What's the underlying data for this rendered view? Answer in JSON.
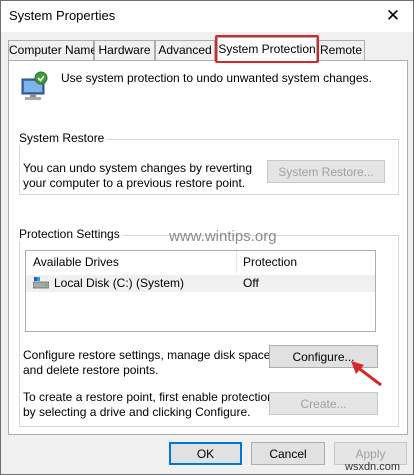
{
  "window": {
    "title": "System Properties",
    "close_glyph": "✕"
  },
  "tabs": [
    {
      "label": "Computer Name",
      "active": false
    },
    {
      "label": "Hardware",
      "active": false
    },
    {
      "label": "Advanced",
      "active": false
    },
    {
      "label": "System Protection",
      "active": true
    },
    {
      "label": "Remote",
      "active": false
    }
  ],
  "intro": {
    "icon": "system-protection-icon",
    "text": "Use system protection to undo unwanted system changes."
  },
  "system_restore": {
    "heading": "System Restore",
    "description_line1": "You can undo system changes by reverting",
    "description_line2": "your computer to a previous restore point.",
    "button_label": "System Restore..."
  },
  "protection_settings": {
    "heading": "Protection Settings",
    "columns": [
      "Available Drives",
      "Protection"
    ],
    "drives": [
      {
        "icon": "drive-icon",
        "name": "Local Disk (C:) (System)",
        "protection": "Off"
      }
    ],
    "configure": {
      "line1": "Configure restore settings, manage disk space,",
      "line2": "and delete restore points.",
      "button_label": "Configure..."
    },
    "create": {
      "line1": "To create a restore point, first enable protection",
      "line2": "by selecting a drive and clicking Configure.",
      "button_label": "Create..."
    }
  },
  "footer": {
    "ok_label": "OK",
    "cancel_label": "Cancel",
    "apply_label": "Apply"
  },
  "watermarks": {
    "center": "www.wintips.org",
    "corner": "wsxdn.com"
  },
  "colors": {
    "highlight": "#d8262b",
    "accent": "#0078d7"
  }
}
